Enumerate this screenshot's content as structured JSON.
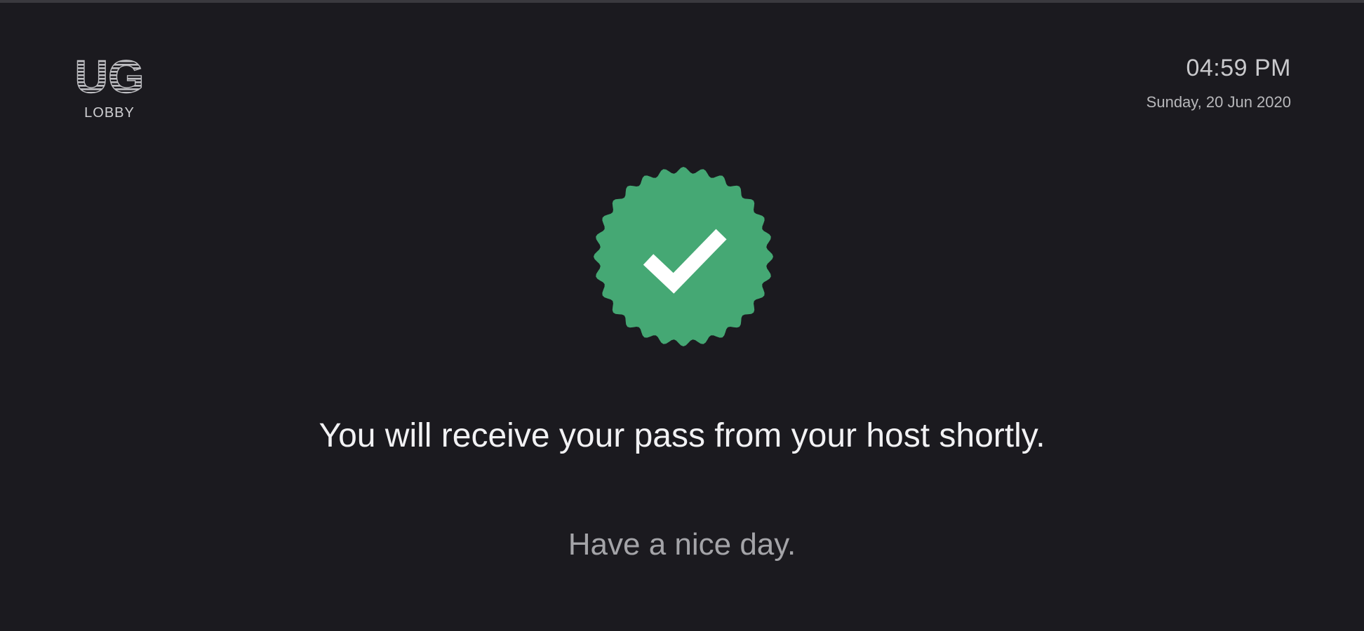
{
  "brand": {
    "logo_text": "UG",
    "label": "LOBBY"
  },
  "clock": {
    "time": "04:59 PM",
    "date": "Sunday, 20 Jun 2020"
  },
  "status": {
    "icon": "check-badge-icon",
    "badge_color": "#45a874",
    "check_color": "#ffffff"
  },
  "message": "You will receive your pass from your host shortly.",
  "farewell": "Have a nice day."
}
